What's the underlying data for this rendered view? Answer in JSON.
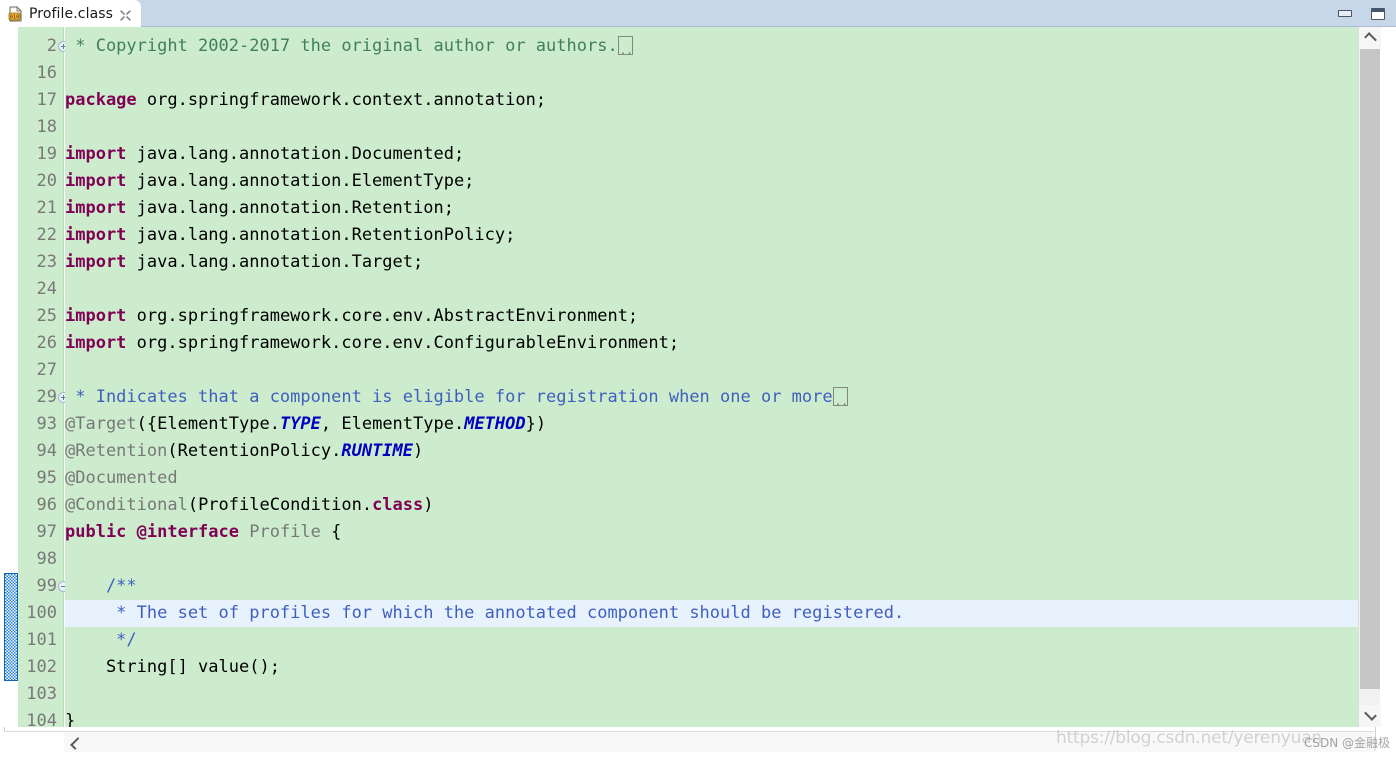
{
  "window": {
    "minimize_label": "Minimize",
    "maximize_label": "Maximize",
    "minimize_icon": "window-minimize-icon",
    "maximize_icon": "window-maximize-icon"
  },
  "tab": {
    "title": "Profile.class",
    "icon": "class-file-icon",
    "close_icon": "close-icon",
    "close_label": "⌧"
  },
  "editor": {
    "fold_box_text": "..",
    "lines": [
      {
        "number": "2",
        "fold": "plus",
        "current": false,
        "change": false,
        "tokens": [
          {
            "cls": "cmt",
            "text": " * Copyright 2002-2017 the original author or authors."
          },
          {
            "cls": "foldbox",
            "text": ""
          }
        ]
      },
      {
        "number": "16",
        "fold": "",
        "current": false,
        "change": false,
        "tokens": []
      },
      {
        "number": "17",
        "fold": "",
        "current": false,
        "change": false,
        "tokens": [
          {
            "cls": "kw",
            "text": "package"
          },
          {
            "cls": "plain",
            "text": " org.springframework.context.annotation;"
          }
        ]
      },
      {
        "number": "18",
        "fold": "",
        "current": false,
        "change": false,
        "tokens": []
      },
      {
        "number": "19",
        "fold": "",
        "current": false,
        "change": false,
        "tokens": [
          {
            "cls": "kw",
            "text": "import"
          },
          {
            "cls": "plain",
            "text": " java.lang.annotation.Documented;"
          }
        ]
      },
      {
        "number": "20",
        "fold": "",
        "current": false,
        "change": false,
        "tokens": [
          {
            "cls": "kw",
            "text": "import"
          },
          {
            "cls": "plain",
            "text": " java.lang.annotation.ElementType;"
          }
        ]
      },
      {
        "number": "21",
        "fold": "",
        "current": false,
        "change": false,
        "tokens": [
          {
            "cls": "kw",
            "text": "import"
          },
          {
            "cls": "plain",
            "text": " java.lang.annotation.Retention;"
          }
        ]
      },
      {
        "number": "22",
        "fold": "",
        "current": false,
        "change": false,
        "tokens": [
          {
            "cls": "kw",
            "text": "import"
          },
          {
            "cls": "plain",
            "text": " java.lang.annotation.RetentionPolicy;"
          }
        ]
      },
      {
        "number": "23",
        "fold": "",
        "current": false,
        "change": false,
        "tokens": [
          {
            "cls": "kw",
            "text": "import"
          },
          {
            "cls": "plain",
            "text": " java.lang.annotation.Target;"
          }
        ]
      },
      {
        "number": "24",
        "fold": "",
        "current": false,
        "change": false,
        "tokens": []
      },
      {
        "number": "25",
        "fold": "",
        "current": false,
        "change": false,
        "tokens": [
          {
            "cls": "kw",
            "text": "import"
          },
          {
            "cls": "plain",
            "text": " org.springframework.core.env.AbstractEnvironment;"
          }
        ]
      },
      {
        "number": "26",
        "fold": "",
        "current": false,
        "change": false,
        "tokens": [
          {
            "cls": "kw",
            "text": "import"
          },
          {
            "cls": "plain",
            "text": " org.springframework.core.env.ConfigurableEnvironment;"
          }
        ]
      },
      {
        "number": "27",
        "fold": "",
        "current": false,
        "change": false,
        "tokens": []
      },
      {
        "number": "29",
        "fold": "plus",
        "current": false,
        "change": false,
        "tokens": [
          {
            "cls": "jdoc",
            "text": " * Indicates that a component is eligible for registration when one or more"
          },
          {
            "cls": "foldbox",
            "text": ""
          }
        ]
      },
      {
        "number": "93",
        "fold": "",
        "current": false,
        "change": false,
        "tokens": [
          {
            "cls": "ann",
            "text": "@Target"
          },
          {
            "cls": "plain",
            "text": "({ElementType."
          },
          {
            "cls": "stat",
            "text": "TYPE"
          },
          {
            "cls": "plain",
            "text": ", ElementType."
          },
          {
            "cls": "stat",
            "text": "METHOD"
          },
          {
            "cls": "plain",
            "text": "})"
          }
        ]
      },
      {
        "number": "94",
        "fold": "",
        "current": false,
        "change": false,
        "tokens": [
          {
            "cls": "ann",
            "text": "@Retention"
          },
          {
            "cls": "plain",
            "text": "(RetentionPolicy."
          },
          {
            "cls": "stat",
            "text": "RUNTIME"
          },
          {
            "cls": "plain",
            "text": ")"
          }
        ]
      },
      {
        "number": "95",
        "fold": "",
        "current": false,
        "change": false,
        "tokens": [
          {
            "cls": "ann",
            "text": "@Documented"
          }
        ]
      },
      {
        "number": "96",
        "fold": "",
        "current": false,
        "change": false,
        "tokens": [
          {
            "cls": "ann",
            "text": "@Conditional"
          },
          {
            "cls": "plain",
            "text": "(ProfileCondition."
          },
          {
            "cls": "kw",
            "text": "class"
          },
          {
            "cls": "plain",
            "text": ")"
          }
        ]
      },
      {
        "number": "97",
        "fold": "",
        "current": false,
        "change": false,
        "tokens": [
          {
            "cls": "kw",
            "text": "public @interface"
          },
          {
            "cls": "ann",
            "text": " Profile "
          },
          {
            "cls": "plain",
            "text": "{"
          }
        ]
      },
      {
        "number": "98",
        "fold": "",
        "current": false,
        "change": false,
        "tokens": []
      },
      {
        "number": "99",
        "fold": "minus",
        "current": false,
        "change": true,
        "tokens": [
          {
            "cls": "jdoc",
            "text": "    /**"
          }
        ]
      },
      {
        "number": "100",
        "fold": "",
        "current": true,
        "change": true,
        "tokens": [
          {
            "cls": "jdoc",
            "text": "     * The set of profiles for which the annotated component should be registered."
          }
        ]
      },
      {
        "number": "101",
        "fold": "",
        "current": false,
        "change": true,
        "tokens": [
          {
            "cls": "jdoc",
            "text": "     */"
          }
        ]
      },
      {
        "number": "102",
        "fold": "",
        "current": false,
        "change": true,
        "tokens": [
          {
            "cls": "plain",
            "text": "    String[] value();"
          }
        ]
      },
      {
        "number": "103",
        "fold": "",
        "current": false,
        "change": false,
        "tokens": []
      },
      {
        "number": "104",
        "fold": "",
        "current": false,
        "change": false,
        "tokens": [
          {
            "cls": "plain",
            "text": "}"
          }
        ]
      }
    ]
  },
  "scrollbars": {
    "v_up_icon": "chevron-up-icon",
    "v_down_icon": "chevron-down-icon",
    "h_left_icon": "chevron-left-icon"
  },
  "watermark": {
    "url": "https://blog.csdn.net/yerenyuan",
    "badge": "CSDN @金融极"
  },
  "colors": {
    "editor_bg": "#cdeccd",
    "current_line": "#e8f2fd",
    "keyword": "#7f0055",
    "block_comment": "#3f7f5f",
    "javadoc": "#3f5fbf",
    "annotation": "#787878",
    "static_field": "#0000c0",
    "tabbar": "#c8d7e8",
    "change_bar": "#1f7fd4"
  }
}
